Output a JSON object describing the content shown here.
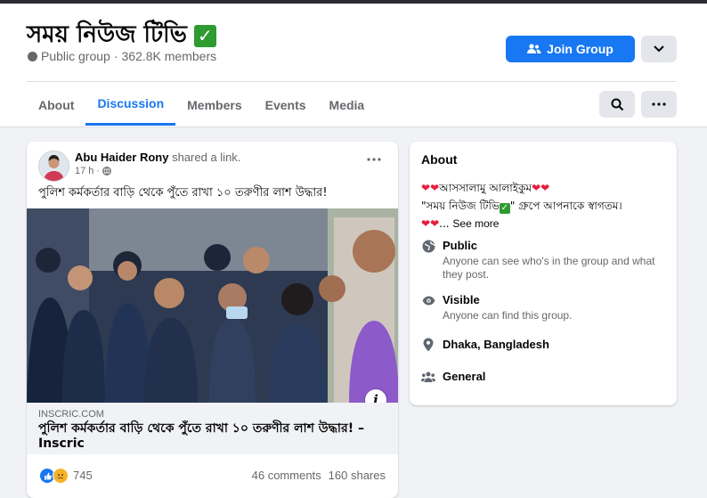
{
  "group": {
    "name": "সময় নিউজ টিভি",
    "privacy_text": "Public group",
    "separator": "·",
    "members_text": "362.8K members",
    "join_label": "Join Group"
  },
  "tabs": [
    {
      "label": "About",
      "active": false
    },
    {
      "label": "Discussion",
      "active": true
    },
    {
      "label": "Members",
      "active": false
    },
    {
      "label": "Events",
      "active": false
    },
    {
      "label": "Media",
      "active": false
    }
  ],
  "post": {
    "author": "Abu Haider Rony",
    "action": "shared a link.",
    "time": "17 h",
    "text": "পুলিশ কর্মকর্তার বাড়ি থেকে পুঁতে রাখা ১০ তরুণীর লাশ উদ্ধার!",
    "link_domain": "INSCRIC.COM",
    "link_title": "পুলিশ কর্মকর্তার বাড়ি থেকে পুঁতে রাখা ১০ তরুণীর লাশ উদ্ধার! – Inscric",
    "reaction_count": "745",
    "comments": "46 comments",
    "shares": "160 shares"
  },
  "about": {
    "heading": "About",
    "greeting": "আসসালামু আলাইকুম",
    "welcome_open": "\"সময় নিউজ টিভি",
    "welcome_close": "\" গ্রুপে আপনাকে স্বাগতম।",
    "see_more": "See more",
    "items": [
      {
        "icon": "globe-icon",
        "title": "Public",
        "sub": "Anyone can see who's in the group and what they post."
      },
      {
        "icon": "eye-icon",
        "title": "Visible",
        "sub": "Anyone can find this group."
      },
      {
        "icon": "location-pin-icon",
        "title": "Dhaka, Bangladesh",
        "sub": ""
      },
      {
        "icon": "people-icon",
        "title": "General",
        "sub": ""
      }
    ]
  },
  "colors": {
    "accent": "#1877f2",
    "check_green": "#2e9b31",
    "heart_red": "#e41e3f",
    "secondary_text": "#65676b"
  }
}
